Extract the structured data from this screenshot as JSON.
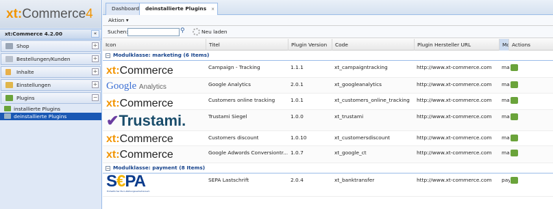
{
  "app": {
    "logo_brand": "xt:",
    "logo_text": "Commerce",
    "logo_version": "4"
  },
  "sidebar": {
    "title": "xt:Commerce 4.2.00",
    "collapse": "«",
    "items": [
      {
        "label": "Shop",
        "toggle": "+"
      },
      {
        "label": "Bestellungen/Kunden",
        "toggle": "+"
      },
      {
        "label": "Inhalte",
        "toggle": "+"
      },
      {
        "label": "Einstellungen",
        "toggle": "+"
      },
      {
        "label": "Plugins",
        "toggle": "−"
      }
    ],
    "subitems": [
      {
        "label": "installierte Plugins"
      },
      {
        "label": "deinstallierte Plugins"
      }
    ]
  },
  "tabs": [
    {
      "label": "Dashboard"
    },
    {
      "label": "deinstallierte Plugins",
      "close": "×"
    }
  ],
  "actionbar": {
    "label": "Aktion ▾"
  },
  "toolbar": {
    "search_label": "Suchen:",
    "search_value": "",
    "reload_label": "Neu laden"
  },
  "grid": {
    "columns": [
      "Icon",
      "Titel",
      "Plugin Version",
      "Code",
      "Plugin Hersteller URL",
      "Mod",
      "Actions"
    ],
    "groups": [
      {
        "toggle": "−",
        "label": "Modulklasse: marketing (6 Items)",
        "rows": [
          {
            "logo": "xtcommerce",
            "title": "Campaign - Tracking",
            "version": "1.1.1",
            "code": "xt_campaigntracking",
            "url": "http://www.xt-commerce.com",
            "mod": "mar"
          },
          {
            "logo": "google",
            "title": "Google Analytics",
            "version": "2.0.1",
            "code": "xt_googleanalytics",
            "url": "http://www.xt-commerce.com",
            "mod": "mar"
          },
          {
            "logo": "xtcommerce",
            "title": "Customers online tracking",
            "version": "1.0.1",
            "code": "xt_customers_online_tracking",
            "url": "http://www.xt-commerce.com",
            "mod": "mar"
          },
          {
            "logo": "trustami",
            "title": "Trustami Siegel",
            "version": "1.0.0",
            "code": "xt_trustami",
            "url": "http://www.xt-commerce.com",
            "mod": "mar"
          },
          {
            "logo": "xtcommerce",
            "title": "Customers discount",
            "version": "1.0.10",
            "code": "xt_customersdiscount",
            "url": "http://www.xt-commerce.com",
            "mod": "mar"
          },
          {
            "logo": "xtcommerce",
            "title": "Google Adwords Conversiontr...",
            "version": "1.0.7",
            "code": "xt_google_ct",
            "url": "http://www.xt-commerce.com",
            "mod": "mar"
          }
        ]
      },
      {
        "toggle": "−",
        "label": "Modulklasse: payment (8 Items)",
        "rows": [
          {
            "logo": "sepa",
            "title": "SEPA Lastschrift",
            "version": "2.0.4",
            "code": "xt_banktransfer",
            "url": "http://www.xt-commerce.com",
            "mod": "pay"
          }
        ]
      }
    ]
  },
  "logos": {
    "xt_brand": "xt:",
    "xt_text": "Commerce",
    "google_text": "Google",
    "google_suffix": "Analytics",
    "trustami_mark": "✔",
    "trustami_text": "Trustami.",
    "sepa_s": "S",
    "sepa_euro": "€",
    "sepa_pa": "PA",
    "sepa_sub": "Einheitlicher Euro-Zahlungsverkehrsraum"
  },
  "colors": {
    "accent": "#f29400",
    "selection": "#1a58b4",
    "group_text": "#15428b",
    "icon_green": "#6aa33a"
  }
}
